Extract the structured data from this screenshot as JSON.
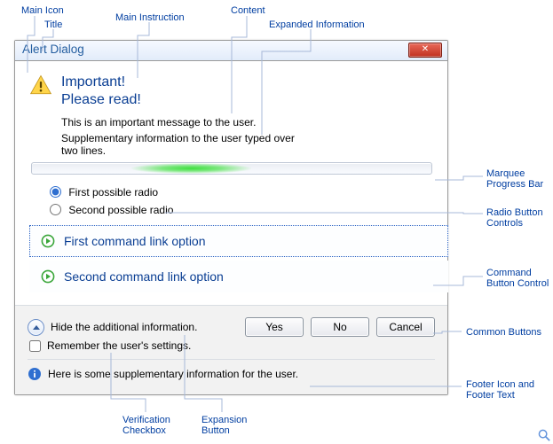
{
  "dialog": {
    "title": "Alert Dialog",
    "close_label": "✕",
    "main_instruction_l1": "Important!",
    "main_instruction_l2": "Please read!",
    "content_p1": "This is an important message to the user.",
    "content_p2": "Supplementary information to the user typed over two lines.",
    "radios": {
      "r1": "First possible radio",
      "r2": "Second possible radio"
    },
    "cmdlinks": {
      "c1": "First command link option",
      "c2": "Second command link option"
    },
    "expand_label": "Hide the additional information.",
    "verify_label": "Remember the user's settings.",
    "buttons": {
      "yes": "Yes",
      "no": "No",
      "cancel": "Cancel"
    },
    "footer_text": "Here is some supplementary information for the user."
  },
  "callouts": {
    "main_icon": "Main Icon",
    "title": "Title",
    "main_instruction": "Main Instruction",
    "content": "Content",
    "expanded_info": "Expanded Information",
    "marquee": "Marquee\nProgress Bar",
    "radios": "Radio Button\nControls",
    "cmdbtn": "Command\nButton Control",
    "common_btns": "Common Buttons",
    "footer": "Footer Icon and\nFooter Text",
    "verify": "Verification\nCheckbox",
    "expand": "Expansion\nButton"
  }
}
